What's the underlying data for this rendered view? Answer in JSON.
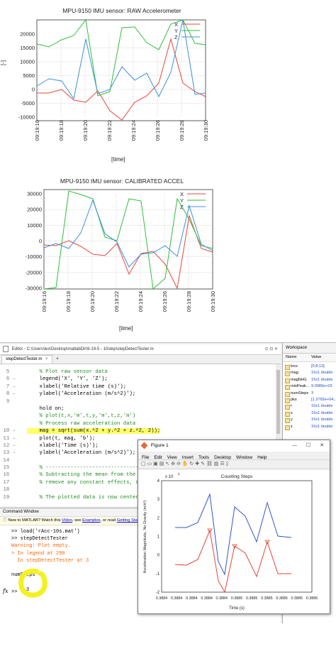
{
  "plot1": {
    "title": "MPU-9150 IMU sensor: RAW Accelerometer",
    "ylabel": "[-]",
    "xlabel": "[time]",
    "yticks": [
      "20000",
      "15000",
      "10000",
      "5000",
      "0",
      "-5000",
      "-10000"
    ],
    "xticks": [
      "09:19:16",
      "09:19:18",
      "09:19:20",
      "09:19:22",
      "09:19:24",
      "09:19:26",
      "09:19:28",
      "09:19:30"
    ],
    "legend": [
      "X",
      "Y",
      "Z"
    ]
  },
  "plot2": {
    "title": "MPU-9150 IMU sensor: CALIBRATED ACCEL",
    "xlabel": "[time]",
    "yticks": [
      "30000",
      "20000",
      "10000",
      "0",
      "-10000",
      "-20000",
      "-30000"
    ],
    "xticks": [
      "09:19:16",
      "09:19:18",
      "09:19:20",
      "09:19:22",
      "09:19:24",
      "09:19:26",
      "09:19:28",
      "09:19:30"
    ],
    "legend": [
      "X",
      "Y",
      "Z"
    ]
  },
  "matlab": {
    "title_path": "Editor - C:\\Users\\lex\\Desktop\\matlabDir\\9-19-5 - 10step\\stepDetectTester.m",
    "editor_tab": "stepDetectTester.m",
    "code_lines": [
      {
        "n": "5",
        "text": "    % Plot raw sensor data",
        "cls": "cmt",
        "dash": false
      },
      {
        "n": "6",
        "text": "    legend('X', 'Y', 'Z');",
        "cls": "",
        "dash": true
      },
      {
        "n": "7",
        "text": "    xlabel('Relative time (s)');",
        "cls": "",
        "dash": true
      },
      {
        "n": "8",
        "text": "    ylabel('Acceleration (m/s^2)');",
        "cls": "",
        "dash": true
      },
      {
        "n": "9",
        "text": "",
        "cls": "",
        "dash": false
      },
      {
        "n": "",
        "text": "    hold on;",
        "cls": "",
        "dash": false
      },
      {
        "n": "",
        "text": "    % plot(t,x,'m',t,y,'m',t,z,'m')",
        "cls": "cmt",
        "dash": false
      },
      {
        "n": "",
        "text": "    % Process raw acceleration data",
        "cls": "cmt",
        "dash": false
      },
      {
        "n": "10",
        "text": "    mag = sqrt(sum(x.^2 + y.^2 + z.^2, 2));",
        "cls": "hl",
        "dash": true
      },
      {
        "n": "11",
        "text": "    plot(t, mag, 'b');",
        "cls": "",
        "dash": true
      },
      {
        "n": "12",
        "text": "    xlabel('Time (s)');",
        "cls": "",
        "dash": true
      },
      {
        "n": "13",
        "text": "    ylabel('Acceleration (m/s^2)');",
        "cls": "",
        "dash": true
      },
      {
        "n": "14",
        "text": "",
        "cls": "",
        "dash": false
      },
      {
        "n": "15",
        "text": "    % ---------------------------------",
        "cls": "cmt",
        "dash": false
      },
      {
        "n": "16",
        "text": "    % Subtracting the mean from the",
        "cls": "cmt",
        "dash": false
      },
      {
        "n": "17",
        "text": "    % remove any constant effects, s",
        "cls": "cmt",
        "dash": false
      },
      {
        "n": "18",
        "text": "",
        "cls": "",
        "dash": false
      },
      {
        "n": "19",
        "text": "    % The plotted data is now center",
        "cls": "cmt",
        "dash": false
      }
    ],
    "workspace": {
      "title": "Workspace",
      "col_name": "Name",
      "col_value": "Value",
      "rows": [
        {
          "name": "locs",
          "value": "[5;8;13]"
        },
        {
          "name": "mag",
          "value": "15x1 double"
        },
        {
          "name": "magNoG",
          "value": "15x1 double"
        },
        {
          "name": "minPeak...",
          "value": "9.0089e+03"
        },
        {
          "name": "numSteps",
          "value": "3"
        },
        {
          "name": "pks",
          "value": "[1.3765e+04;..."
        },
        {
          "name": "t",
          "value": "15x1 double"
        },
        {
          "name": "x",
          "value": "15x1 double"
        },
        {
          "name": "y",
          "value": "15x1 double"
        },
        {
          "name": "z",
          "value": "15x1 double"
        }
      ]
    },
    "command_window": {
      "title": "Command Window",
      "notice_prefix": "New to MATLAB? Watch this",
      "notice_link1": "Video",
      "notice_mid": ", see",
      "notice_link2": "Examples",
      "notice_mid2": ", or read",
      "notice_link3": "Getting Start",
      "lines": [
        {
          "text": ">> load('rAcc-10s.mat')",
          "cls": ""
        },
        {
          "text": ">> stepDetectTester",
          "cls": ""
        },
        {
          "text": "Warning: Plot empty.",
          "cls": "warn"
        },
        {
          "text": "> In legend at 290",
          "cls": "warn"
        },
        {
          "text": "  In stepDetectTester at 3",
          "cls": "warn"
        },
        {
          "text": "",
          "cls": ""
        },
        {
          "text": "numSteps =",
          "cls": ""
        },
        {
          "text": "",
          "cls": ""
        },
        {
          "text": "     3",
          "cls": ""
        }
      ],
      "prompt": ">>",
      "fx": "fx"
    }
  },
  "figure": {
    "window_title": "Figure 1",
    "menu": [
      "File",
      "Edit",
      "View",
      "Insert",
      "Tools",
      "Desktop",
      "Window",
      "Help"
    ],
    "plot_title": "Counting Steps",
    "exponent": "x 10",
    "exponent_power": "4",
    "ylabel": "Acceleration Magnitude, No Gravity (m/s²)",
    "xlabel": "Time (s)",
    "yticks": [
      "4",
      "3",
      "2",
      "1",
      "0",
      "-1",
      "-2"
    ],
    "xticks": [
      "0.3884",
      "0.3884",
      "0.3884",
      "0.3884",
      "0.3884",
      "0.3885",
      "0.3885",
      "0.3885",
      "0.3885",
      "0.3885",
      "0.3886"
    ]
  },
  "colors": {
    "red": "#e8453c",
    "green": "#2fbf3a",
    "blue": "#3d8fe0",
    "matlab_blue": "#3355cc",
    "highlight_yellow": "#ffff66",
    "annotation_yellow": "#f4f11c"
  }
}
